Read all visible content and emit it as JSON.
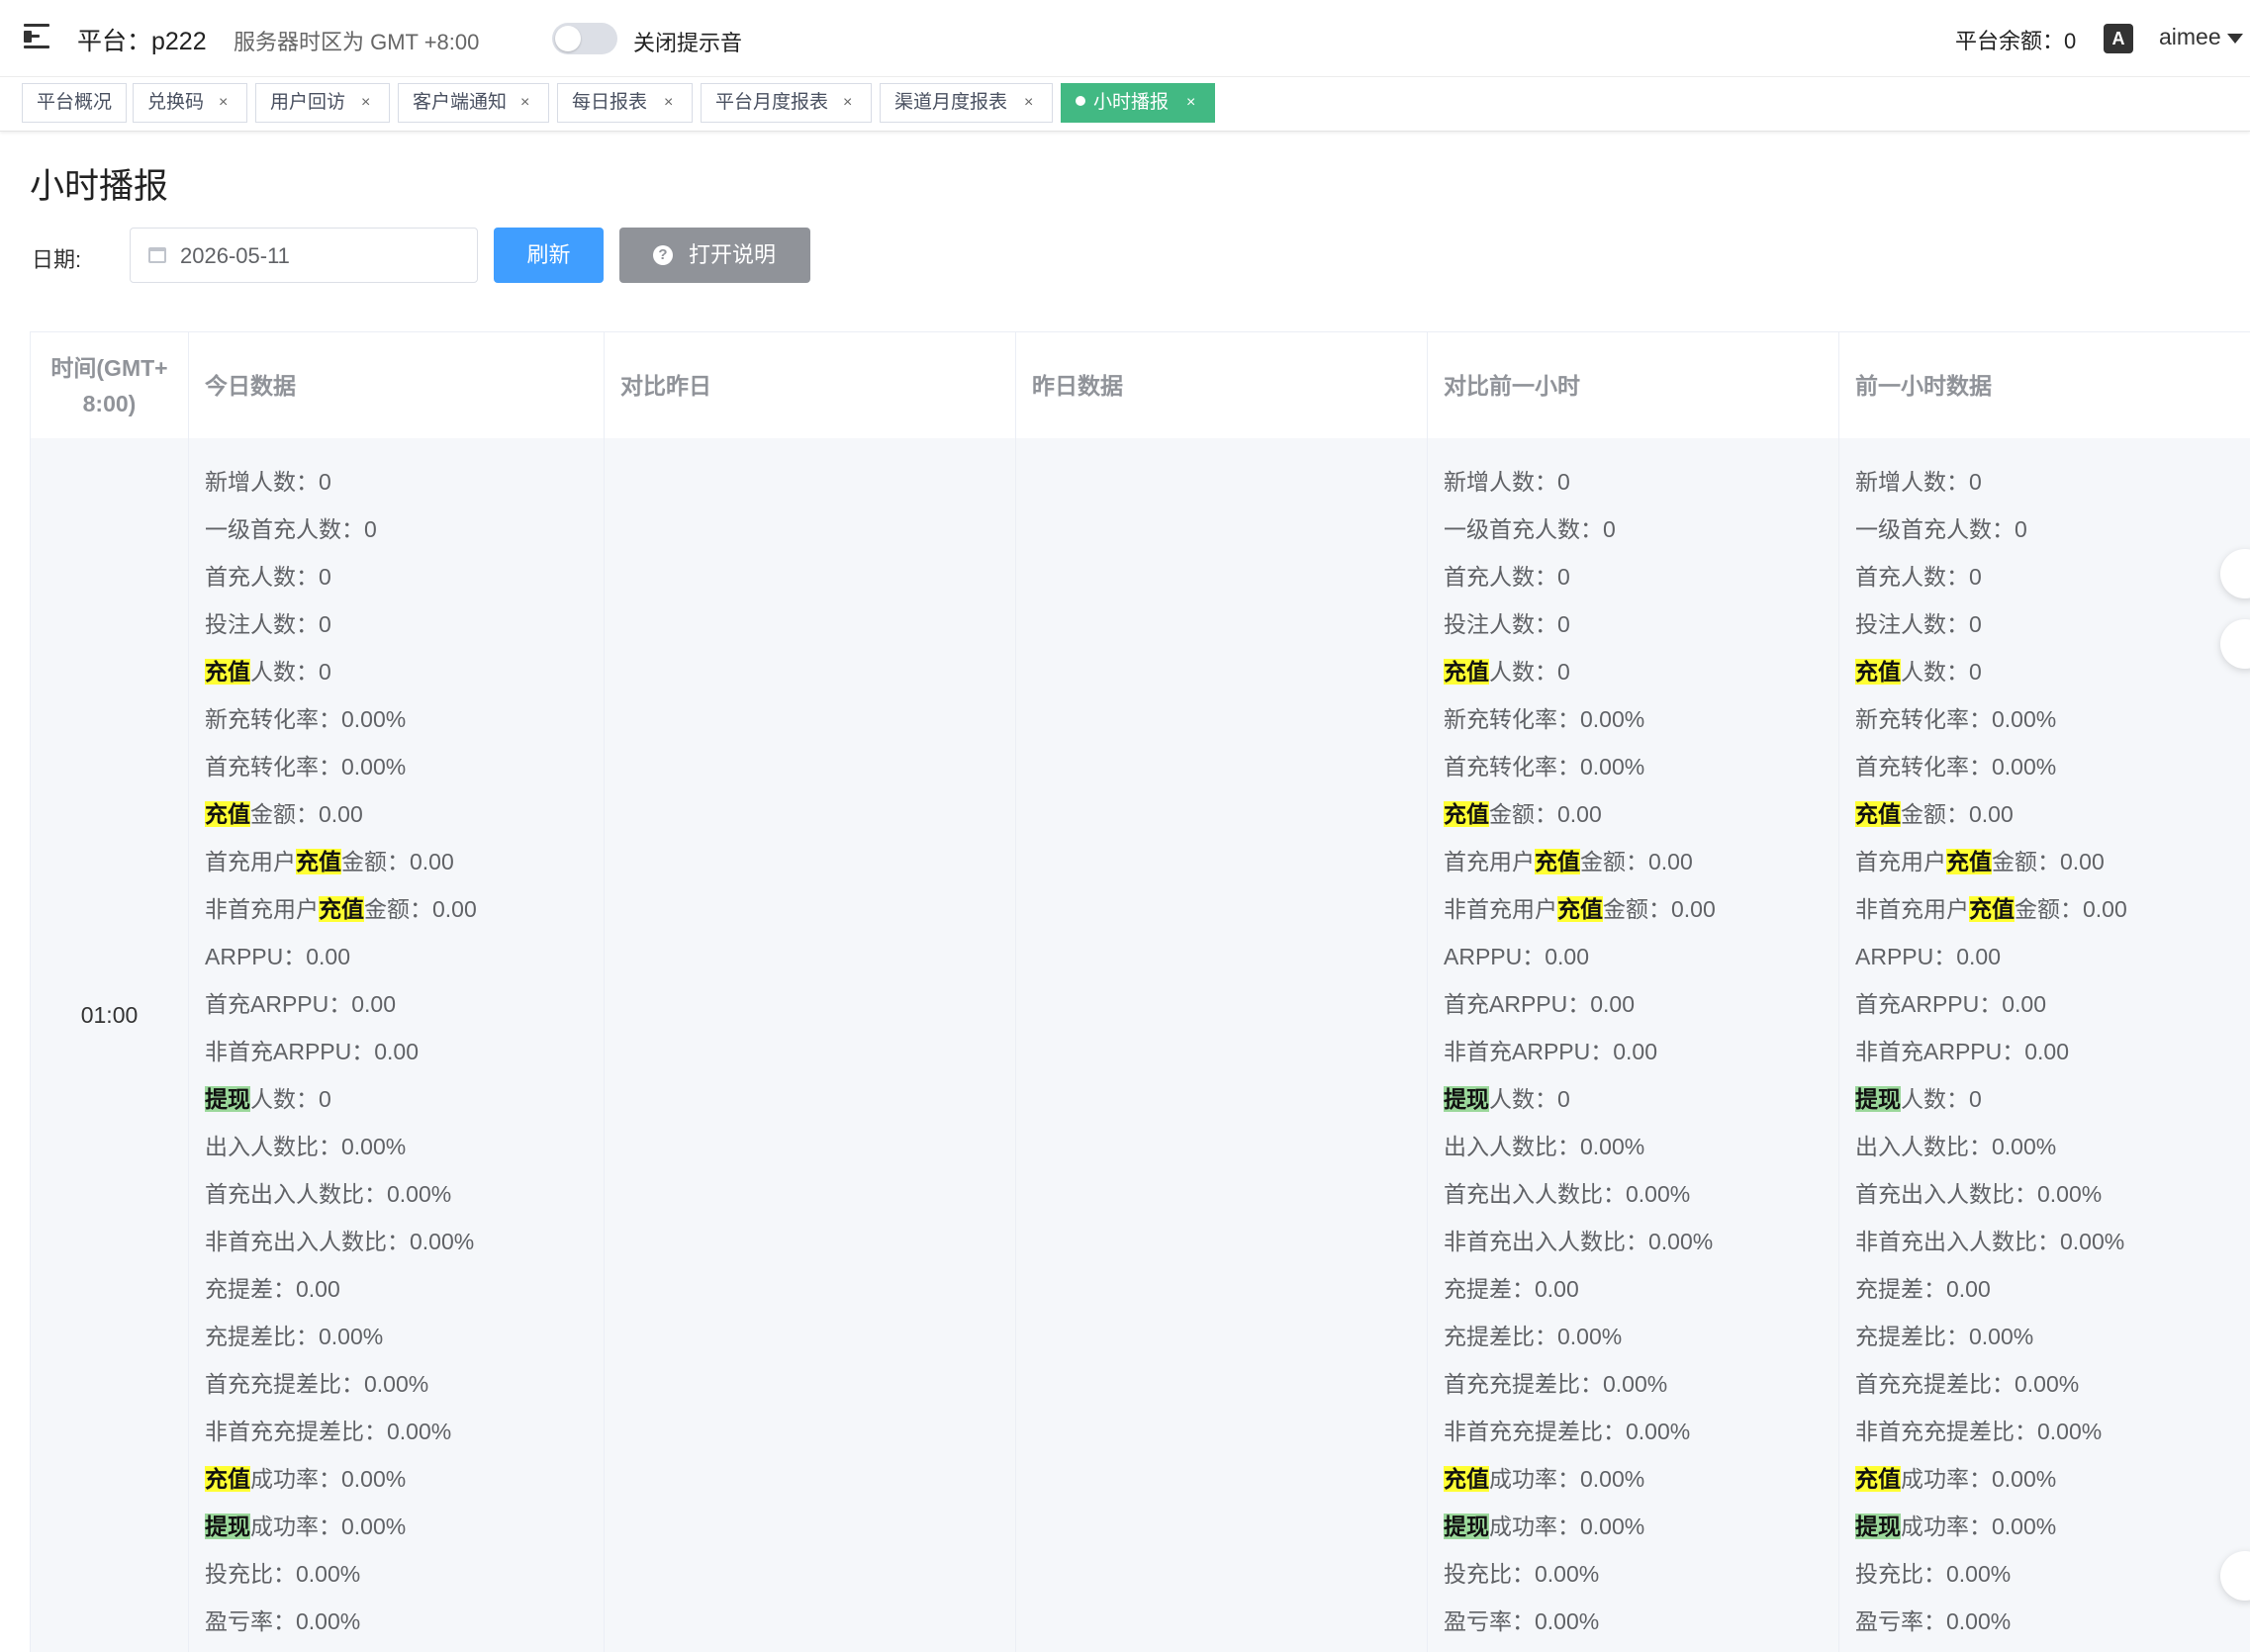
{
  "header": {
    "platform": "平台：p222",
    "timezone": "服务器时区为 GMT +8:00",
    "sound_label": "关闭提示音",
    "balance": "平台余额：0",
    "lang_icon": "A",
    "user": "aimee"
  },
  "tabs": [
    {
      "label": "平台概况",
      "closable": false
    },
    {
      "label": "兑换码",
      "closable": true
    },
    {
      "label": "用户回访",
      "closable": true
    },
    {
      "label": "客户端通知",
      "closable": true
    },
    {
      "label": "每日报表",
      "closable": true
    },
    {
      "label": "平台月度报表",
      "closable": true
    },
    {
      "label": "渠道月度报表",
      "closable": true
    },
    {
      "label": "小时播报",
      "closable": true,
      "active": true
    }
  ],
  "page": {
    "title": "小时播报",
    "date_label": "日期:",
    "date_value": "2026-05-11",
    "refresh_label": "刷新",
    "help_label": "打开说明"
  },
  "table": {
    "headers": [
      "时间(GMT+8:00)",
      "今日数据",
      "对比昨日",
      "昨日数据",
      "对比前一小时",
      "前一小时数据"
    ],
    "time_header_lines": [
      "时间(GMT+",
      "8:00)"
    ],
    "row_time": "01:00",
    "metrics": [
      {
        "parts": [
          {
            "t": "新增人数：0"
          }
        ]
      },
      {
        "parts": [
          {
            "t": "一级首充人数：0"
          }
        ]
      },
      {
        "parts": [
          {
            "t": "首充人数：0"
          }
        ]
      },
      {
        "parts": [
          {
            "t": "投注人数：0"
          }
        ]
      },
      {
        "parts": [
          {
            "t": "充值",
            "hl": "y"
          },
          {
            "t": "人数：0"
          }
        ]
      },
      {
        "parts": [
          {
            "t": "新充转化率：0.00%"
          }
        ]
      },
      {
        "parts": [
          {
            "t": "首充转化率：0.00%"
          }
        ]
      },
      {
        "parts": [
          {
            "t": "充值",
            "hl": "y"
          },
          {
            "t": "金额：0.00"
          }
        ]
      },
      {
        "parts": [
          {
            "t": "首充用户"
          },
          {
            "t": "充值",
            "hl": "y"
          },
          {
            "t": "金额：0.00"
          }
        ]
      },
      {
        "parts": [
          {
            "t": "非首充用户"
          },
          {
            "t": "充值",
            "hl": "y"
          },
          {
            "t": "金额：0.00"
          }
        ]
      },
      {
        "parts": [
          {
            "t": "ARPPU：0.00"
          }
        ]
      },
      {
        "parts": [
          {
            "t": "首充ARPPU：0.00"
          }
        ]
      },
      {
        "parts": [
          {
            "t": "非首充ARPPU：0.00"
          }
        ]
      },
      {
        "parts": [
          {
            "t": "提现",
            "hl": "g"
          },
          {
            "t": "人数：0"
          }
        ]
      },
      {
        "parts": [
          {
            "t": "出入人数比：0.00%"
          }
        ]
      },
      {
        "parts": [
          {
            "t": "首充出入人数比：0.00%"
          }
        ]
      },
      {
        "parts": [
          {
            "t": "非首充出入人数比：0.00%"
          }
        ]
      },
      {
        "parts": [
          {
            "t": "充提差：0.00"
          }
        ]
      },
      {
        "parts": [
          {
            "t": "充提差比：0.00%"
          }
        ]
      },
      {
        "parts": [
          {
            "t": "首充充提差比：0.00%"
          }
        ]
      },
      {
        "parts": [
          {
            "t": "非首充充提差比：0.00%"
          }
        ]
      },
      {
        "parts": [
          {
            "t": "充值",
            "hl": "y"
          },
          {
            "t": "成功率：0.00%"
          }
        ]
      },
      {
        "parts": [
          {
            "t": "提现",
            "hl": "g"
          },
          {
            "t": "成功率：0.00%"
          }
        ]
      },
      {
        "parts": [
          {
            "t": "投充比：0.00%"
          }
        ]
      },
      {
        "parts": [
          {
            "t": "盈亏率：0.00%"
          }
        ]
      }
    ],
    "filled_columns": [
      "今日数据",
      "对比前一小时",
      "前一小时数据"
    ]
  },
  "colors": {
    "primary": "#409eff",
    "active_tab": "#42b983",
    "highlight_recharge": "#ffff33",
    "highlight_withdraw": "#9bd89b"
  }
}
